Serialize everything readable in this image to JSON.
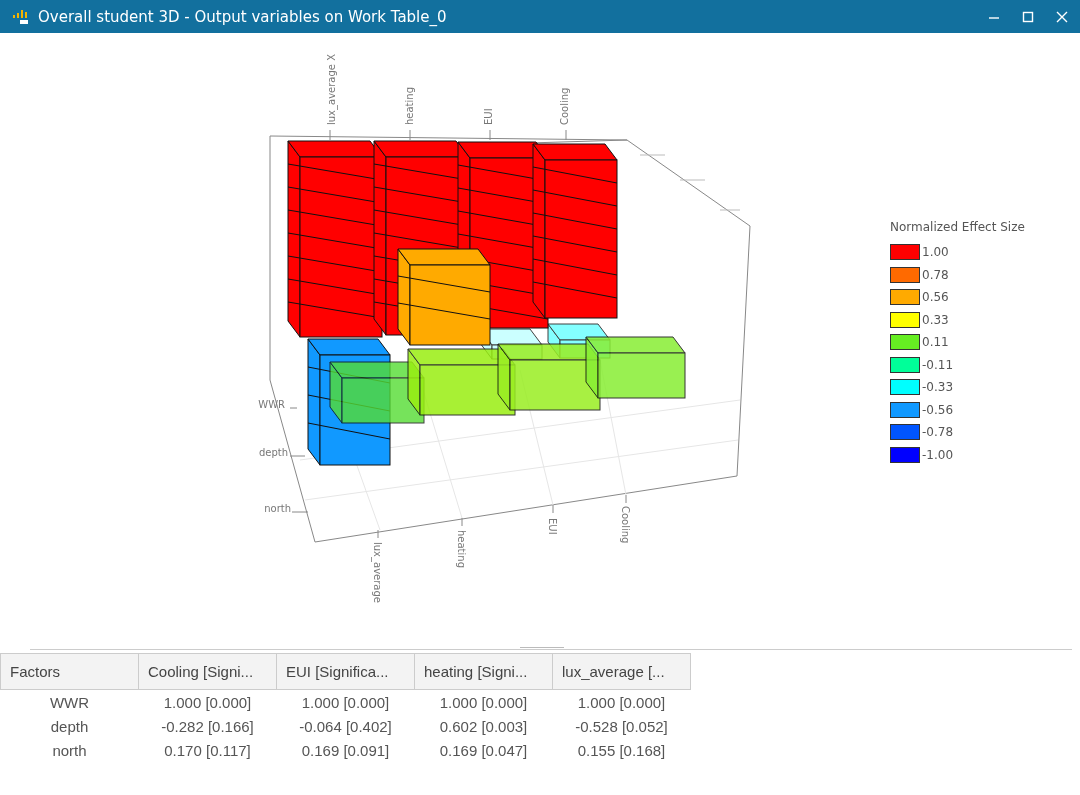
{
  "window": {
    "title": "Overall student 3D - Output variables on Work Table_0"
  },
  "chart": {
    "top_labels": [
      "lux_average X",
      "heating",
      "EUI",
      "Cooling"
    ],
    "row_labels": [
      "WWR",
      "depth",
      "north"
    ],
    "bottom_labels": [
      "lux_average",
      "heating",
      "EUI",
      "Cooling"
    ]
  },
  "legend": {
    "title": "Normalized Effect Size",
    "items": [
      {
        "label": "1.00",
        "color": "#ff0000"
      },
      {
        "label": "0.78",
        "color": "#ff6a00"
      },
      {
        "label": "0.56",
        "color": "#ffaa00"
      },
      {
        "label": "0.33",
        "color": "#ffff00"
      },
      {
        "label": "0.11",
        "color": "#66ee22"
      },
      {
        "label": "-0.11",
        "color": "#00ff99"
      },
      {
        "label": "-0.33",
        "color": "#00ffff"
      },
      {
        "label": "-0.56",
        "color": "#1199ff"
      },
      {
        "label": "-0.78",
        "color": "#0055ff"
      },
      {
        "label": "-1.00",
        "color": "#0000ff"
      }
    ]
  },
  "table": {
    "columns": [
      "Factors",
      "Cooling [Signi...",
      "EUI [Significa...",
      "heating [Signi...",
      "lux_average [..."
    ],
    "rows": [
      [
        "WWR",
        "1.000 [0.000]",
        "1.000 [0.000]",
        "1.000 [0.000]",
        "1.000 [0.000]"
      ],
      [
        "depth",
        "-0.282 [0.166]",
        "-0.064 [0.402]",
        "0.602 [0.003]",
        "-0.528 [0.052]"
      ],
      [
        "north",
        "0.170 [0.117]",
        "0.169 [0.091]",
        "0.169 [0.047]",
        "0.155 [0.168]"
      ]
    ]
  }
}
